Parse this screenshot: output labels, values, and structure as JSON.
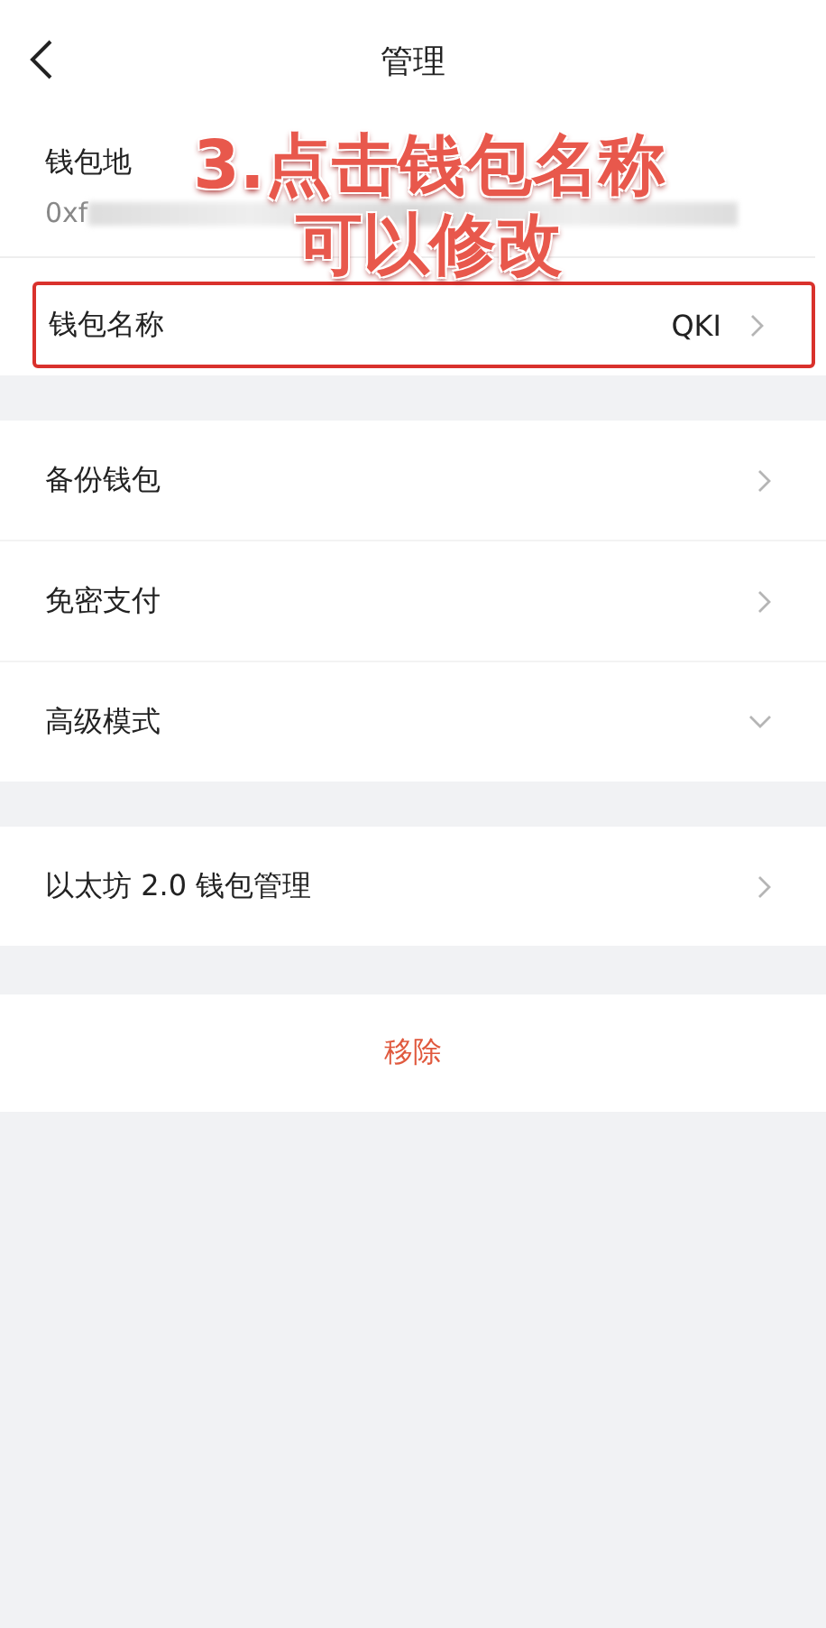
{
  "header": {
    "title": "管理"
  },
  "wallet": {
    "address_label": "钱包地",
    "address_prefix": "0xf",
    "name_row": {
      "label": "钱包名称",
      "value": "QKI",
      "highlighted": true
    }
  },
  "groups": [
    {
      "items": [
        {
          "label": "备份钱包",
          "kind": "arrow"
        },
        {
          "label": "免密支付",
          "kind": "arrow"
        },
        {
          "label": "高级模式",
          "kind": "expand"
        }
      ]
    },
    {
      "items": [
        {
          "label": "以太坊 2.0 钱包管理",
          "kind": "arrow"
        }
      ]
    }
  ],
  "remove_button": {
    "label": "移除"
  },
  "annotation": {
    "lines": [
      "3.点击钱包名称",
      "可以修改"
    ]
  }
}
